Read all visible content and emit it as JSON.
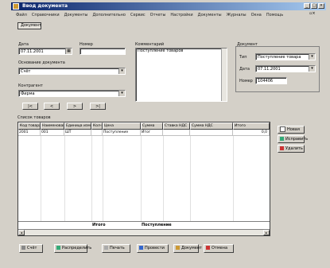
{
  "window": {
    "title": "Ввод документа"
  },
  "menu": [
    "Файл",
    "Справочники",
    "Документы",
    "Дополнительно",
    "Сервис",
    "Отчеты",
    "Настройки",
    "Документы",
    "Журналы",
    "Окна",
    "Помощь"
  ],
  "top_tab": "Документ",
  "form": {
    "date_label": "Дата",
    "date_value": "07.11.2001",
    "number_label": "Номер",
    "number_value": "",
    "basis_label": "Основание документа",
    "basis_value": "Счёт",
    "comment_label": "Комментарий",
    "comment_value": "Поступление товаров",
    "contragent_label": "Контрагент",
    "contragent_value": "Фирма",
    "nav_buttons": [
      "|<",
      "<",
      ">",
      ">|"
    ],
    "accounts_group": "Документ",
    "acc_rows": [
      {
        "label": "Тип",
        "value": "Поступление товара"
      },
      {
        "label": "Дата",
        "value": "07.11.2001"
      },
      {
        "label": "Номер",
        "value": "104406"
      }
    ]
  },
  "grid": {
    "title": "Список товаров",
    "columns": [
      "Код товара",
      "Наименование",
      "Единица изм.",
      "Кол-во",
      "Цена",
      "Сумма",
      "Ставка НДС",
      "Сумма НДС",
      "Итого"
    ],
    "rows": [
      [
        "2001",
        "001",
        "ШТ",
        "",
        "Поступление",
        "Итог",
        "",
        "",
        "0,0"
      ]
    ],
    "footer": {
      "total_label": "Итого",
      "total_value": "Поступление"
    }
  },
  "side_buttons": [
    "Новая",
    "Исправить",
    "Удалить"
  ],
  "bottom_buttons": [
    "Счёт",
    "Распределить",
    "Печать",
    "Провести",
    "Документ",
    "Отмена"
  ]
}
